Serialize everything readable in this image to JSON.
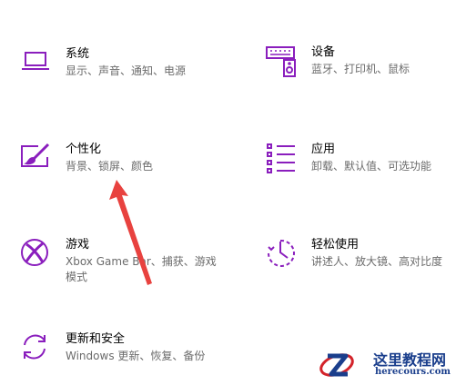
{
  "colors": {
    "accent": "#8a1ebd",
    "arrow": "#e8423f",
    "watermark": "#1a3e8c"
  },
  "tiles": {
    "system": {
      "title": "系统",
      "desc": "显示、声音、通知、电源",
      "icon": "laptop-icon"
    },
    "devices": {
      "title": "设备",
      "desc": "蓝牙、打印机、鼠标",
      "icon": "keyboard-speaker-icon"
    },
    "personalization": {
      "title": "个性化",
      "desc": "背景、锁屏、颜色",
      "icon": "paint-brush-icon"
    },
    "apps": {
      "title": "应用",
      "desc": "卸载、默认值、可选功能",
      "icon": "app-list-icon"
    },
    "gaming": {
      "title": "游戏",
      "desc": "Xbox Game Bar、捕获、游戏模式",
      "icon": "xbox-icon"
    },
    "ease": {
      "title": "轻松使用",
      "desc": "讲述人、放大镜、高对比度",
      "icon": "ease-of-access-icon"
    },
    "update": {
      "title": "更新和安全",
      "desc": "Windows 更新、恢复、备份",
      "icon": "sync-icon"
    }
  },
  "watermark": {
    "title": "这里教程网",
    "url": "herecours.com"
  }
}
